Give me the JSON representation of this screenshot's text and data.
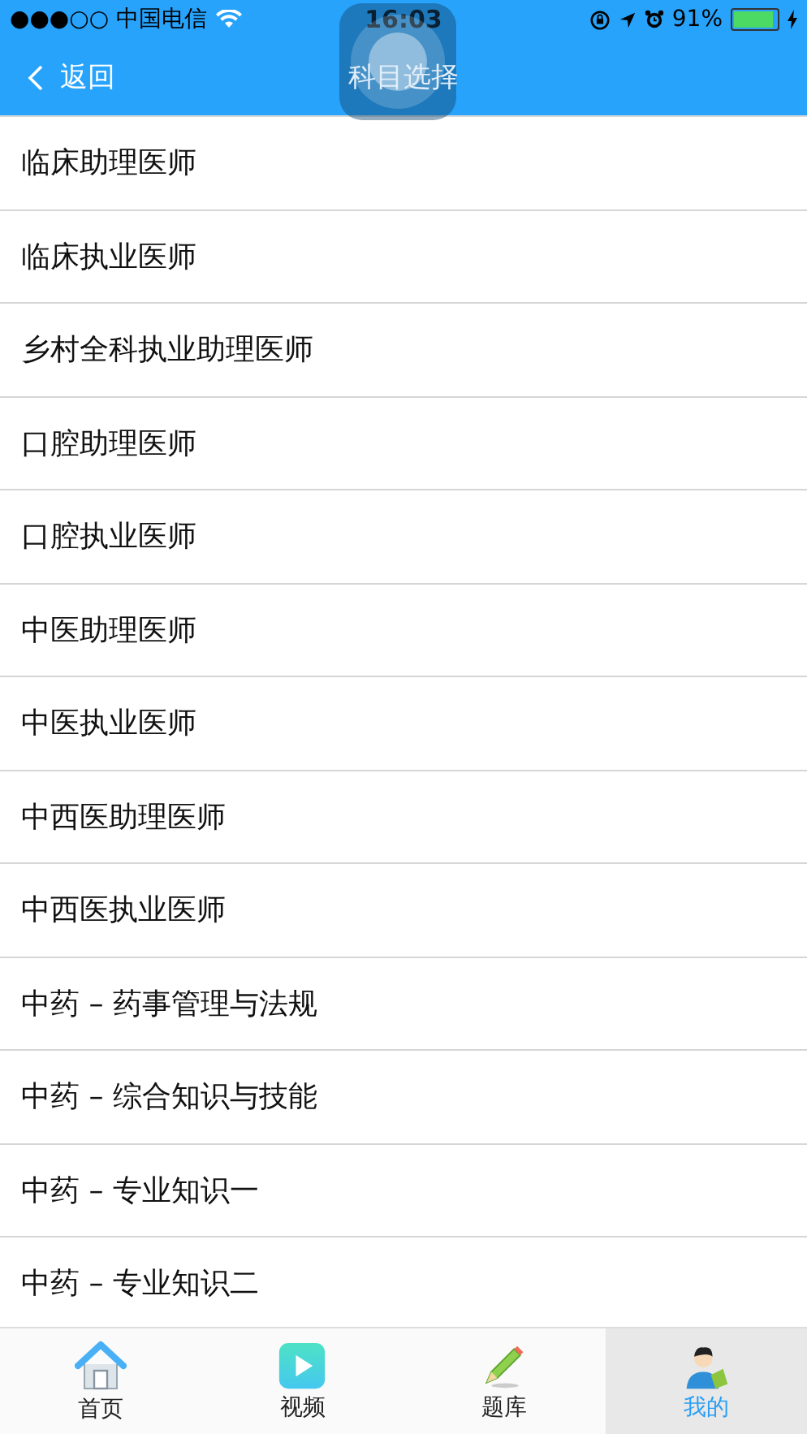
{
  "status_bar": {
    "carrier": "●●●○○ 中国电信",
    "time": "16:03",
    "battery_text": "91%",
    "battery": {
      "level": 0.91
    }
  },
  "nav_bar": {
    "back": "返回",
    "title": "科目选择"
  },
  "subjects": [
    {
      "label": "临床助理医师"
    },
    {
      "label": "临床执业医师"
    },
    {
      "label": "乡村全科执业助理医师"
    },
    {
      "label": "口腔助理医师"
    },
    {
      "label": "口腔执业医师"
    },
    {
      "label": "中医助理医师"
    },
    {
      "label": "中医执业医师"
    },
    {
      "label": "中西医助理医师"
    },
    {
      "label": "中西医执业医师"
    },
    {
      "label": "中药 – 药事管理与法规"
    },
    {
      "label": "中药 – 综合知识与技能"
    },
    {
      "label": "中药 – 专业知识一"
    },
    {
      "label": "中药 – 专业知识二"
    }
  ],
  "tab_bar": [
    {
      "label": "首页",
      "kind": "home",
      "selected": false
    },
    {
      "label": "视频",
      "kind": "video",
      "selected": false
    },
    {
      "label": "题库",
      "kind": "pencil",
      "selected": false
    },
    {
      "label": "我的",
      "kind": "profile",
      "selected": true
    }
  ]
}
